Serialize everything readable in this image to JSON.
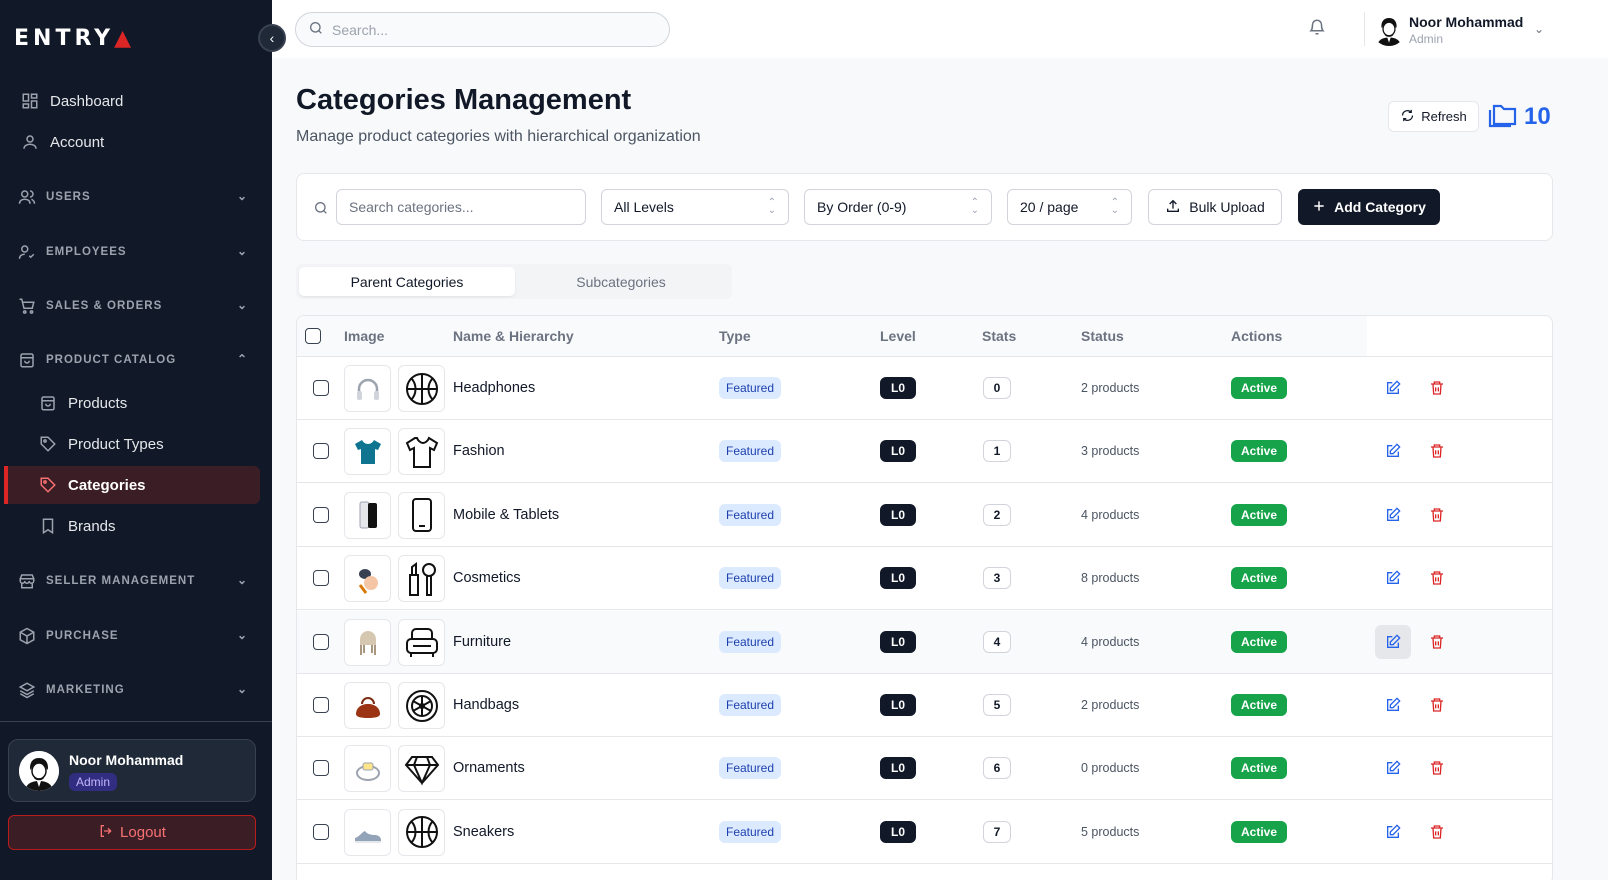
{
  "brand": {
    "logo_main": "ENTRY",
    "logo_accent": "▲",
    "accent_color": "#dc2626",
    "sidebar_bg": "#111827"
  },
  "topbar": {
    "search_placeholder": "Search...",
    "user_name": "Noor Mohammad",
    "user_role": "Admin"
  },
  "sidebar": {
    "items": [
      {
        "label": "Dashboard",
        "icon": "dashboard-icon"
      },
      {
        "label": "Account",
        "icon": "user-icon"
      }
    ],
    "groups": [
      {
        "label": "USERS",
        "icon": "users-icon",
        "expanded": false
      },
      {
        "label": "EMPLOYEES",
        "icon": "user-check-icon",
        "expanded": false
      },
      {
        "label": "SALES & ORDERS",
        "icon": "cart-icon",
        "expanded": false
      },
      {
        "label": "PRODUCT CATALOG",
        "icon": "shopping-bag-icon",
        "expanded": true
      },
      {
        "label": "SELLER MANAGEMENT",
        "icon": "store-icon",
        "expanded": false
      },
      {
        "label": "PURCHASE",
        "icon": "package-icon",
        "expanded": false
      },
      {
        "label": "MARKETING",
        "icon": "layers-icon",
        "expanded": false
      }
    ],
    "catalog_items": [
      {
        "label": "Products",
        "icon": "shopping-bag-icon",
        "active": false
      },
      {
        "label": "Product Types",
        "icon": "tag-icon",
        "active": false
      },
      {
        "label": "Categories",
        "icon": "tag-icon",
        "active": true
      },
      {
        "label": "Brands",
        "icon": "bookmark-icon",
        "active": false
      }
    ],
    "user_name": "Noor Mohammad",
    "user_role": "Admin",
    "logout_label": "Logout"
  },
  "header": {
    "title": "Categories Management",
    "subtitle": "Manage product categories with hierarchical organization",
    "refresh_label": "Refresh",
    "total_count": "10"
  },
  "filters": {
    "search_placeholder": "Search categories...",
    "level_select": "All Levels",
    "sort_select": "By Order (0-9)",
    "page_size_select": "20 / page",
    "bulk_upload_label": "Bulk Upload",
    "add_label": "Add Category"
  },
  "tabs": [
    {
      "label": "Parent Categories",
      "active": true
    },
    {
      "label": "Subcategories",
      "active": false
    }
  ],
  "table": {
    "columns": [
      "Image",
      "Name & Hierarchy",
      "Type",
      "Level",
      "Stats",
      "Status",
      "Actions"
    ],
    "rows": [
      {
        "name": "Headphones",
        "type": "Featured",
        "level": "L0",
        "order": "0",
        "stats": "2 products",
        "status": "Active",
        "photo_icon": "headphones-photo-icon",
        "category_icon": "basketball-icon"
      },
      {
        "name": "Fashion",
        "type": "Featured",
        "level": "L0",
        "order": "1",
        "stats": "3 products",
        "status": "Active",
        "photo_icon": "tshirt-photo-icon",
        "category_icon": "tshirt-icon"
      },
      {
        "name": "Mobile & Tablets",
        "type": "Featured",
        "level": "L0",
        "order": "2",
        "stats": "4 products",
        "status": "Active",
        "photo_icon": "phone-photo-icon",
        "category_icon": "smartphone-icon"
      },
      {
        "name": "Cosmetics",
        "type": "Featured",
        "level": "L0",
        "order": "3",
        "stats": "8 products",
        "status": "Active",
        "photo_icon": "cosmetics-photo-icon",
        "category_icon": "cosmetics-icon"
      },
      {
        "name": "Furniture",
        "type": "Featured",
        "level": "L0",
        "order": "4",
        "stats": "4 products",
        "status": "Active",
        "photo_icon": "chair-photo-icon",
        "category_icon": "armchair-icon"
      },
      {
        "name": "Handbags",
        "type": "Featured",
        "level": "L0",
        "order": "5",
        "stats": "2 products",
        "status": "Active",
        "photo_icon": "handbag-photo-icon",
        "category_icon": "wheel-icon"
      },
      {
        "name": "Ornaments",
        "type": "Featured",
        "level": "L0",
        "order": "6",
        "stats": "0 products",
        "status": "Active",
        "photo_icon": "ring-photo-icon",
        "category_icon": "diamond-icon"
      },
      {
        "name": "Sneakers",
        "type": "Featured",
        "level": "L0",
        "order": "7",
        "stats": "5 products",
        "status": "Active",
        "photo_icon": "sneaker-photo-icon",
        "category_icon": "basketball-icon"
      }
    ]
  }
}
